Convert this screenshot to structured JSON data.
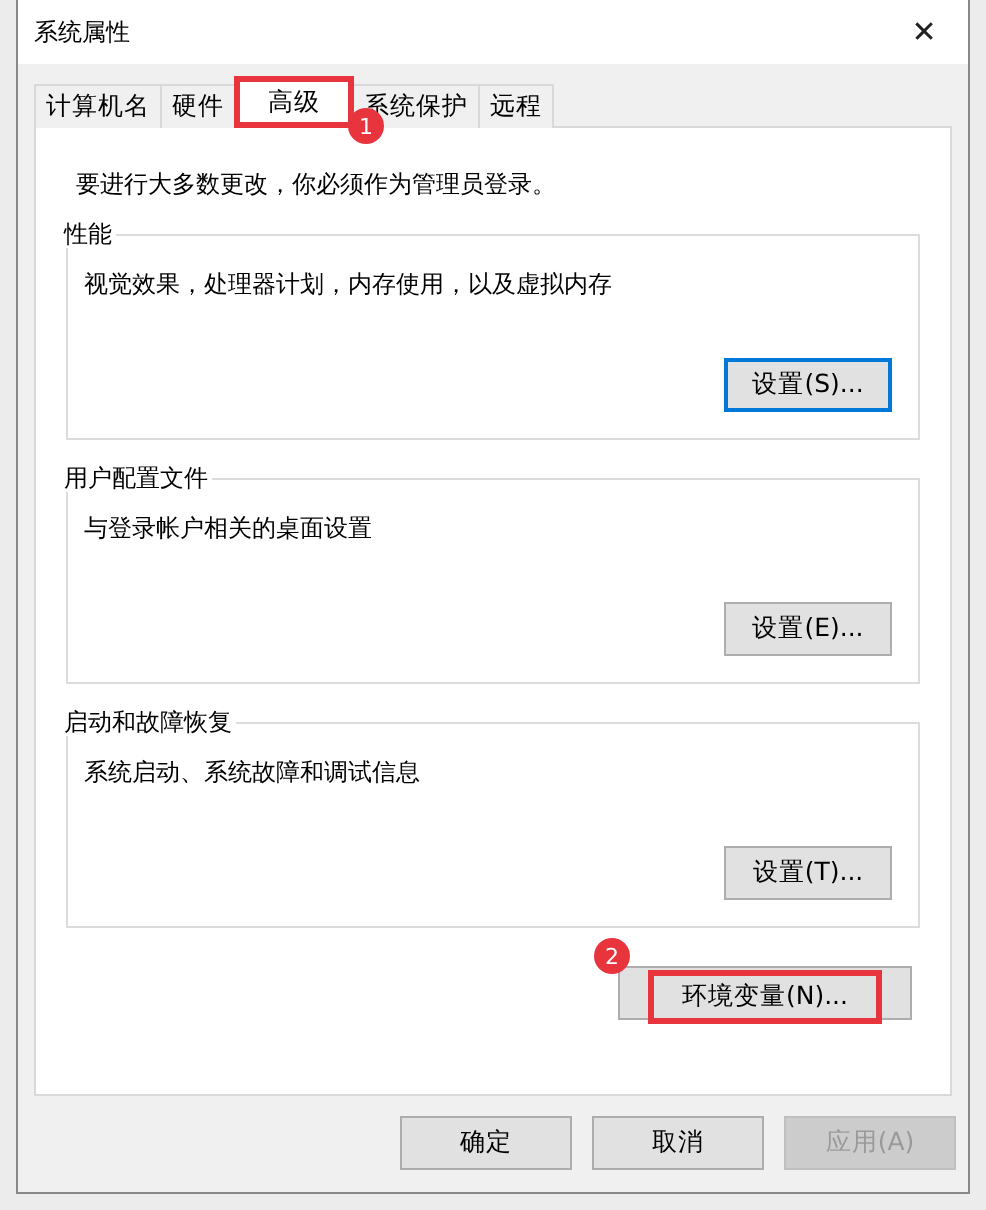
{
  "window": {
    "title": "系统属性",
    "close": "✕"
  },
  "tabs": [
    {
      "label": "计算机名",
      "selected": false,
      "highlighted": false
    },
    {
      "label": "硬件",
      "selected": false,
      "highlighted": false
    },
    {
      "label": "高级",
      "selected": true,
      "highlighted": true,
      "badge": "1"
    },
    {
      "label": "系统保护",
      "selected": false,
      "highlighted": false
    },
    {
      "label": "远程",
      "selected": false,
      "highlighted": false
    }
  ],
  "notice": "要进行大多数更改，你必须作为管理员登录。",
  "groups": [
    {
      "title": "性能",
      "description": "视觉效果，处理器计划，内存使用，以及虚拟内存",
      "button": {
        "label": "设置(S)...",
        "focused": true
      }
    },
    {
      "title": "用户配置文件",
      "description": "与登录帐户相关的桌面设置",
      "button": {
        "label": "设置(E)...",
        "focused": false
      }
    },
    {
      "title": "启动和故障恢复",
      "description": "系统启动、系统故障和调试信息",
      "button": {
        "label": "设置(T)...",
        "focused": false
      }
    }
  ],
  "env_button": {
    "label": "环境变量(N)...",
    "highlighted": true,
    "badge": "2"
  },
  "footer_buttons": [
    {
      "label": "确定",
      "disabled": false
    },
    {
      "label": "取消",
      "disabled": false
    },
    {
      "label": "应用(A)",
      "disabled": true
    }
  ]
}
